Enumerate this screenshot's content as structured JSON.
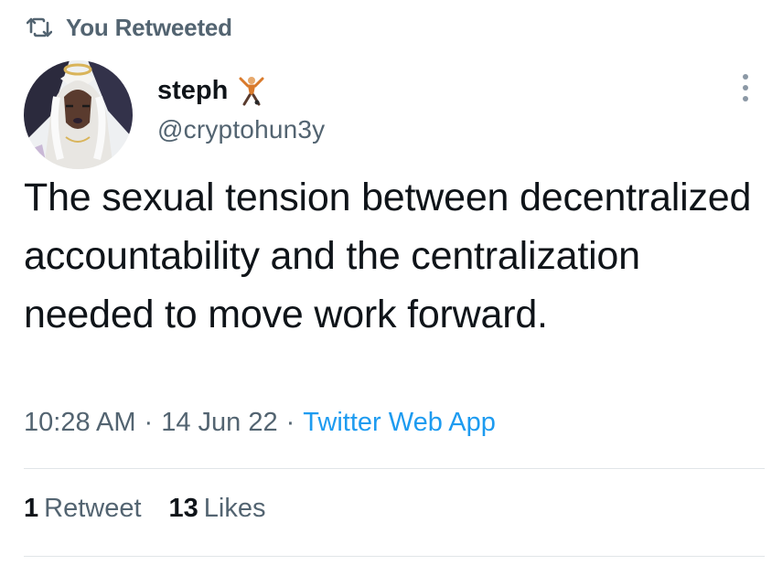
{
  "context": {
    "label": "You Retweeted",
    "icon": "retweet-icon"
  },
  "author": {
    "name": "steph",
    "badge_icon": "figure-emoji-icon",
    "handle": "@cryptohun3y",
    "avatar": "avatar-illustration"
  },
  "tweet": {
    "text": "The sexual tension between decentralized accountability and the centralization needed to move work forward.",
    "time": "10:28 AM",
    "date": "14 Jun 22",
    "separator": "·",
    "source": "Twitter Web App"
  },
  "stats": {
    "retweets": {
      "count": "1",
      "label": "Retweet"
    },
    "likes": {
      "count": "13",
      "label": "Likes"
    }
  },
  "more_icon": "more-vertical-icon",
  "colors": {
    "primary_text": "#0f1419",
    "secondary_text": "#536471",
    "accent": "#1d9bf0",
    "divider": "#e1e5e8"
  }
}
